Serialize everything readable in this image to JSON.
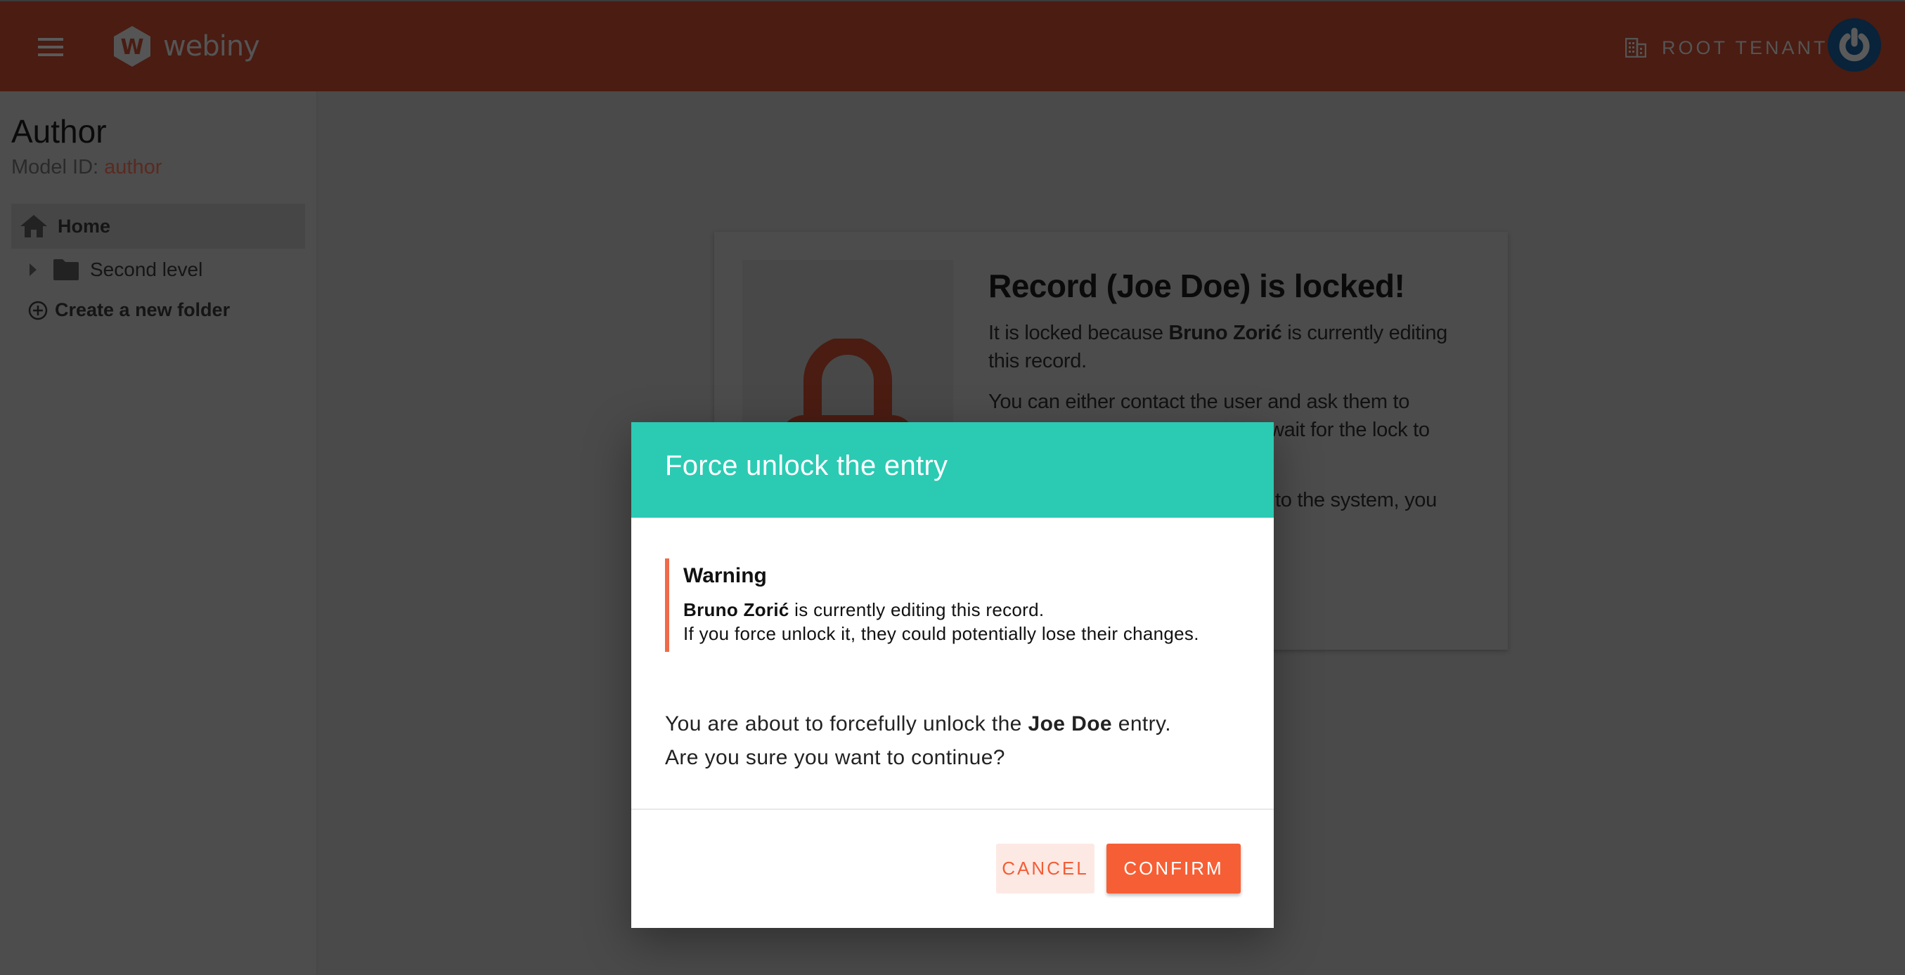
{
  "header": {
    "menu_icon": "hamburger-menu-icon",
    "logo_text": "webiny",
    "tenant_icon": "building-icon",
    "tenant_label": "ROOT TENANT",
    "avatar_icon": "power-icon",
    "colors": {
      "header_bg": "#4a1c12",
      "avatar_bg": "#08233a"
    }
  },
  "sidebar": {
    "title": "Author",
    "model_id_label": "Model ID:",
    "model_id_value": "author",
    "tree": [
      {
        "label": "Home",
        "icon": "home-icon",
        "selected": true
      },
      {
        "label": "Second level",
        "icon": "folder-icon",
        "expandable": true
      }
    ],
    "create_folder_label": "Create a new folder"
  },
  "lock_card": {
    "title": "Record (Joe Doe) is locked!",
    "p1_prefix": "It is locked because ",
    "p1_user": "Bruno Zorić",
    "p1_suffix": " is currently editing this record.",
    "p2_visible": "You can either contact the user and ask them to",
    "p2_partial": "wait for the lock to",
    "p3_partial": "to the system, you"
  },
  "dialog": {
    "title": "Force unlock the entry",
    "warning": {
      "title": "Warning",
      "user": "Bruno Zorić",
      "line1_suffix": " is currently editing this record.",
      "line2": "If you force unlock it, they could potentially lose their changes."
    },
    "message_prefix": "You are about to forcefully unlock the ",
    "message_entry": "Joe Doe",
    "message_suffix": " entry.",
    "question": "Are you sure you want to continue?",
    "cancel_label": "CANCEL",
    "confirm_label": "CONFIRM",
    "colors": {
      "header_bg": "#2bcab3",
      "accent": "#f65f35",
      "warning_border": "#ef6a4a"
    }
  }
}
